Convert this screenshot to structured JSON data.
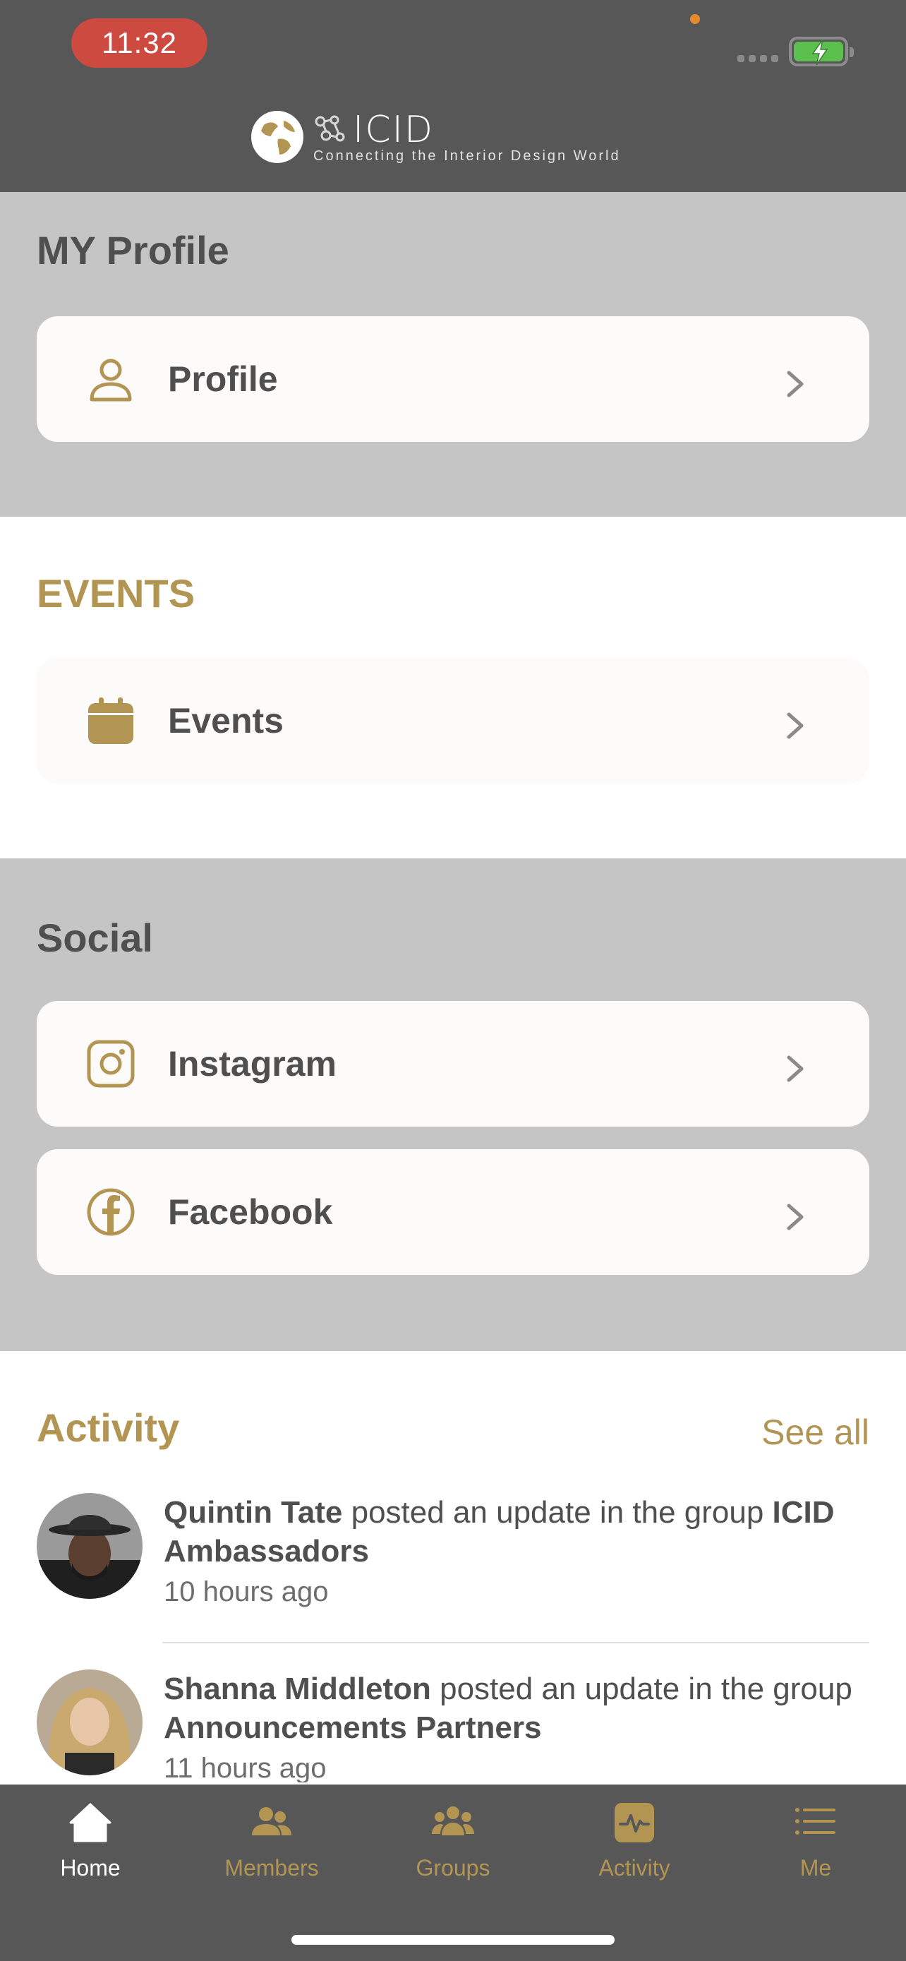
{
  "status_bar": {
    "time": "11:32"
  },
  "header": {
    "brand": "ICID",
    "tagline": "Connecting the Interior Design World"
  },
  "my_profile": {
    "title": "MY Profile",
    "items": [
      {
        "label": "Profile",
        "icon": "person-icon"
      }
    ]
  },
  "events": {
    "title": "EVENTS",
    "items": [
      {
        "label": "Events",
        "icon": "calendar-icon"
      }
    ]
  },
  "social": {
    "title": "Social",
    "items": [
      {
        "label": "Instagram",
        "icon": "instagram-icon"
      },
      {
        "label": "Facebook",
        "icon": "facebook-icon"
      }
    ]
  },
  "activity": {
    "title": "Activity",
    "see_all": "See all",
    "items": [
      {
        "user": "Quintin Tate",
        "action": " posted an update in the group ",
        "group": "ICID Ambassadors",
        "time": "10 hours ago"
      },
      {
        "user": "Shanna Middleton",
        "action": " posted an update in the group ",
        "group": "Announcements Partners",
        "time": "11 hours ago"
      }
    ]
  },
  "tabbar": {
    "items": [
      {
        "label": "Home",
        "icon": "home-icon",
        "active": true
      },
      {
        "label": "Members",
        "icon": "members-icon",
        "active": false
      },
      {
        "label": "Groups",
        "icon": "groups-icon",
        "active": false
      },
      {
        "label": "Activity",
        "icon": "activity-icon",
        "active": false
      },
      {
        "label": "Me",
        "icon": "menu-icon",
        "active": false
      }
    ]
  },
  "colors": {
    "gold": "#b39553",
    "header_bg": "#575757",
    "section_gray": "#c5c5c5",
    "time_pill": "#cc4a3f"
  }
}
